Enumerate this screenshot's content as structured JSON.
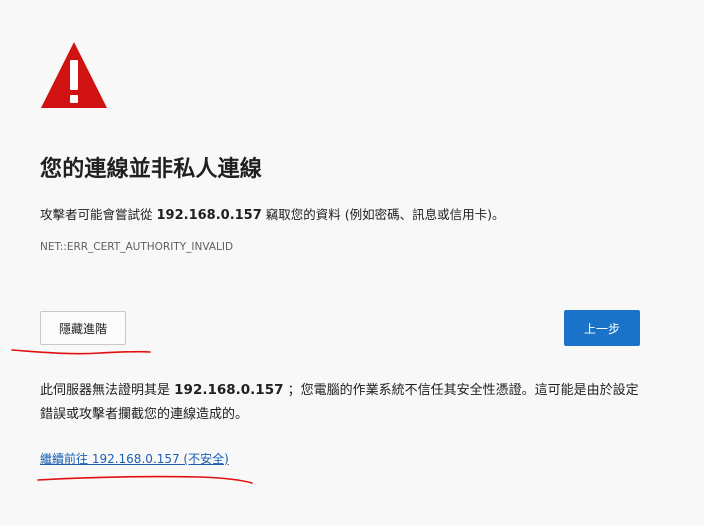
{
  "title": "您的連線並非私人連線",
  "intro": {
    "prefix": "攻擊者可能會嘗試從",
    "host": "192.168.0.157",
    "suffix": "竊取您的資料 (例如密碼、訊息或信用卡)。"
  },
  "error_code": "NET::ERR_CERT_AUTHORITY_INVALID",
  "buttons": {
    "advanced_label": "隱藏進階",
    "back_label": "上一步"
  },
  "details": {
    "prefix": "此伺服器無法證明其是",
    "host": "192.168.0.157",
    "suffix": "；您電腦的作業系統不信任其安全性憑證。這可能是由於設定錯誤或攻擊者攔截您的連線造成的。"
  },
  "proceed_link": "繼續前往 192.168.0.157 (不安全)",
  "colors": {
    "warning_red": "#d01212",
    "primary_button": "#1a73c8",
    "link": "#1a5fb4",
    "annotation_red": "#e01010"
  }
}
